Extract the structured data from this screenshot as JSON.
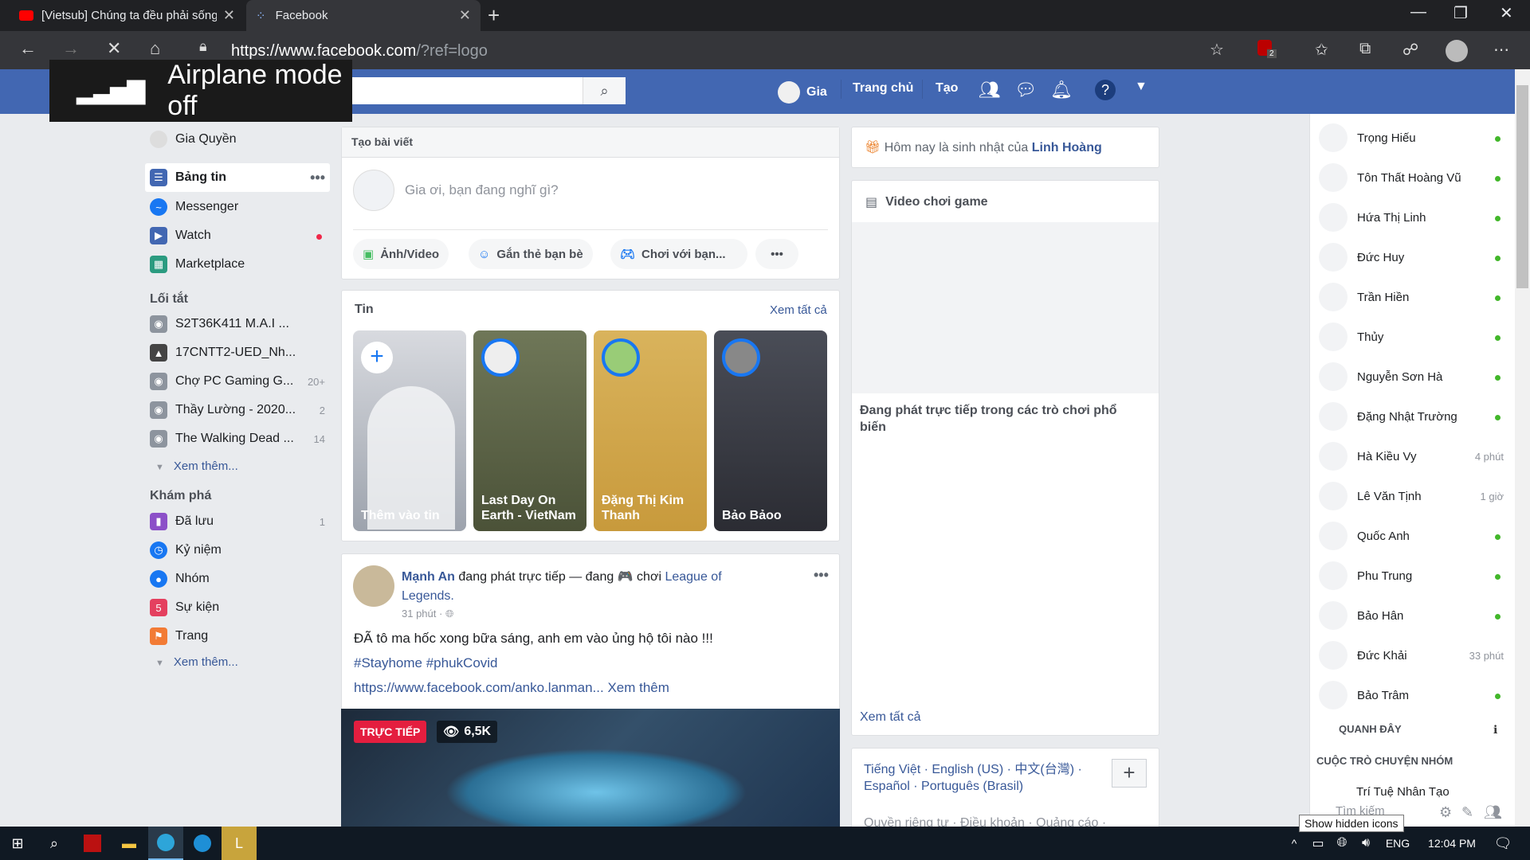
{
  "browser": {
    "tabs": [
      {
        "title": "[Vietsub] Chúng ta đều phải sống"
      },
      {
        "title": "Facebook"
      }
    ],
    "url_main": "https://www.facebook.com",
    "url_rest": "/?ref=logo",
    "ext_badge": "2"
  },
  "airplane": {
    "text": "Airplane mode off"
  },
  "header": {
    "user": "Gia",
    "home": "Trang chủ",
    "create": "Tạo"
  },
  "left_nav": {
    "profile": "Gia Quyền",
    "main": [
      {
        "label": "Bảng tin"
      },
      {
        "label": "Messenger"
      },
      {
        "label": "Watch"
      },
      {
        "label": "Marketplace"
      }
    ],
    "shortcuts_title": "Lối tắt",
    "shortcuts": [
      {
        "label": "S2T36K411 M.A.I ...",
        "count": ""
      },
      {
        "label": "17CNTT2-UED_Nh...",
        "count": ""
      },
      {
        "label": "Chợ PC Gaming G...",
        "count": "20+"
      },
      {
        "label": "Thầy Lường - 2020...",
        "count": "2"
      },
      {
        "label": "The Walking Dead ...",
        "count": "14"
      }
    ],
    "see_more": "Xem thêm...",
    "explore_title": "Khám phá",
    "explore": [
      {
        "label": "Đã lưu",
        "count": "1"
      },
      {
        "label": "Kỷ niệm",
        "count": ""
      },
      {
        "label": "Nhóm",
        "count": ""
      },
      {
        "label": "Sự kiện",
        "count": ""
      },
      {
        "label": "Trang",
        "count": ""
      }
    ]
  },
  "composer": {
    "title": "Tạo bài viết",
    "placeholder": "Gia ơi, bạn đang nghĩ gì?",
    "actions": [
      "Ảnh/Video",
      "Gắn thẻ bạn bè",
      "Chơi với bạn...",
      "•••"
    ]
  },
  "stories": {
    "title": "Tin",
    "see_all": "Xem tất cả",
    "items": [
      {
        "label": "Thêm vào tin"
      },
      {
        "label": "Last Day On Earth - VietNam"
      },
      {
        "label": "Đặng Thị Kim Thanh"
      },
      {
        "label": "Bảo Bảoo"
      }
    ]
  },
  "post": {
    "author": "Mạnh An",
    "action": "đang phát trực tiếp — đang 🎮 chơi",
    "game": "League of Legends.",
    "time": "31 phút",
    "text": "ĐÃ tô ma hốc xong bữa sáng, anh em vào ủng hộ tôi nào !!!",
    "tags": "#Stayhome #phukCovid",
    "link": "https://www.facebook.com/anko.lanman...",
    "see_more": "Xem thêm",
    "live_badge": "TRỰC TIẾP",
    "viewers": "6,5K"
  },
  "right": {
    "birthday_prefix": "Hôm nay là sinh nhật của",
    "birthday_name": "Linh Hoàng",
    "game_title": "Video chơi game",
    "game_desc": "Đang phát trực tiếp trong các trò chơi phổ biến",
    "game_see_all": "Xem tất cả",
    "langs_line1": "Tiếng Việt · English (US) · 中文(台灣) ·",
    "langs_line2": "Español · Português (Brasil)",
    "footer": "Quyền riêng tư · Điều khoản · Quảng cáo ·"
  },
  "chat": {
    "contacts": [
      {
        "name": "Trọng Hiếu",
        "status": ""
      },
      {
        "name": "Tôn Thất Hoàng Vũ",
        "status": ""
      },
      {
        "name": "Hứa Thị Linh",
        "status": ""
      },
      {
        "name": "Đức Huy",
        "status": ""
      },
      {
        "name": "Trần Hiền",
        "status": ""
      },
      {
        "name": "Thủy",
        "status": ""
      },
      {
        "name": "Nguyễn Sơn Hà",
        "status": ""
      },
      {
        "name": "Đặng Nhật Trường",
        "status": ""
      },
      {
        "name": "Hà Kiều Vy",
        "status": "4 phút"
      },
      {
        "name": "Lê Văn Tịnh",
        "status": "1 giờ"
      },
      {
        "name": "Quốc Anh",
        "status": ""
      },
      {
        "name": "Phu Trung",
        "status": ""
      },
      {
        "name": "Bảo Hân",
        "status": ""
      },
      {
        "name": "Đức Khải",
        "status": "33 phút"
      },
      {
        "name": "Bảo Trâm",
        "status": ""
      }
    ],
    "nearby": "QUANH ĐÂY",
    "groups": "CUỘC TRÒ CHUYỆN NHÓM",
    "group_item": "Trí Tuệ Nhân Tạo",
    "search": "Tìm kiếm"
  },
  "taskbar": {
    "tooltip": "Show hidden icons",
    "lang": "ENG",
    "time": "12:04 PM"
  }
}
